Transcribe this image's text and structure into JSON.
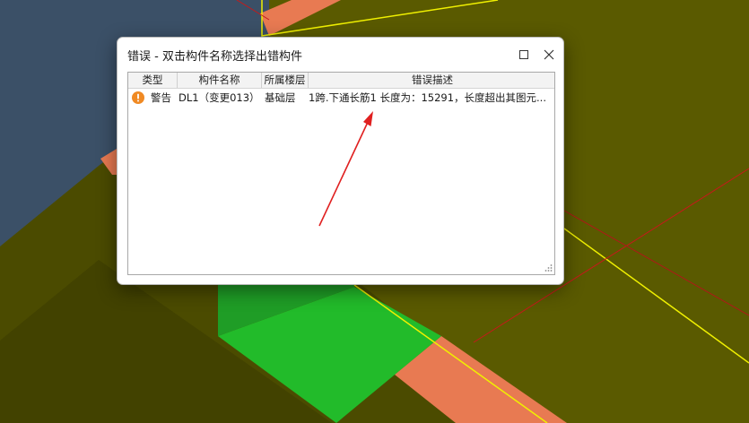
{
  "dialog": {
    "title": "错误 - 双击构件名称选择出错构件",
    "maximize_icon": "maximize-icon",
    "close_icon": "close-icon"
  },
  "table": {
    "columns": [
      "类型",
      "构件名称",
      "所属楼层",
      "错误描述"
    ],
    "rows": [
      {
        "icon": "warning-icon",
        "type": "警告",
        "name": "DL1（变更013）",
        "floor": "基础层",
        "description": "1跨.下通长筋1 长度为：15291，长度超出其图元..."
      }
    ]
  },
  "colors": {
    "background_olive": "#4a4a00",
    "olive_plane": "#5a5a00",
    "slate_blue": "#3a5068",
    "salmon_beam": "#e87a52",
    "green_block": "#22bb2a",
    "yellow_edge": "#f0f000",
    "red_line": "#c41a1a",
    "warning_orange": "#f08a24",
    "annotation_arrow": "#e02020"
  }
}
